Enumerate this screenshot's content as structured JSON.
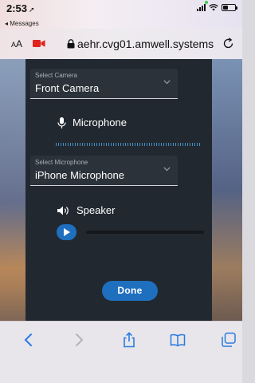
{
  "status_bar": {
    "time": "2:53",
    "location_glyph": "➚",
    "back_to_app": "◂ Messages",
    "battery_level": 0.4,
    "icons": [
      "signal-icon",
      "wifi-icon",
      "battery-icon"
    ]
  },
  "browser": {
    "text_size_label": "AA",
    "url": "aehr.cvg01.amwell.systems",
    "icons": [
      "camera-recording-icon",
      "lock-icon",
      "reload-icon"
    ],
    "toolbar_icons": [
      "back-icon",
      "forward-icon",
      "share-icon",
      "bookmarks-icon",
      "tabs-icon"
    ]
  },
  "settings": {
    "camera": {
      "label": "Select Camera",
      "value": "Front Camera"
    },
    "microphone": {
      "heading": "Microphone",
      "select_label": "Select Microphone",
      "value": "iPhone Microphone"
    },
    "speaker": {
      "heading": "Speaker",
      "playback_progress": 0.0
    },
    "done_label": "Done"
  },
  "colors": {
    "modal_bg": "#22282f",
    "accent_blue": "#1f6fbf",
    "level_blue": "#4aa3df"
  }
}
